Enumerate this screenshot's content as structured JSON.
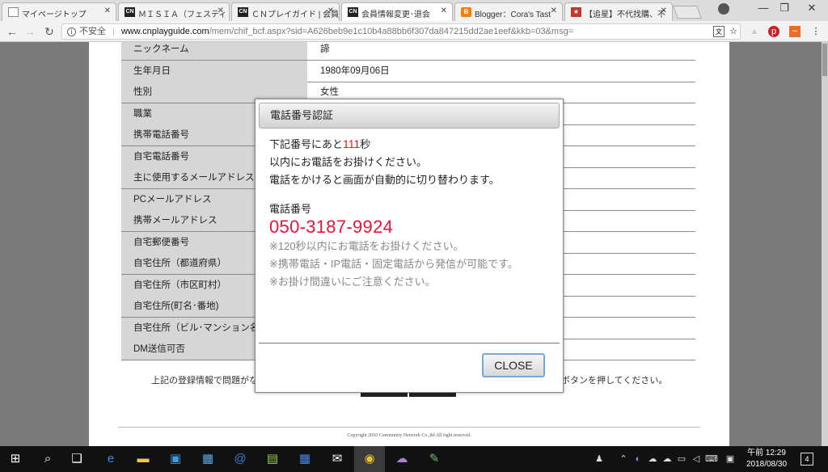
{
  "tabs": [
    {
      "favicon": "page-icon",
      "title": "マイページトップ"
    },
    {
      "favicon": "cn-icon",
      "title": "ＭＩＳＩＡ（フェスティ"
    },
    {
      "favicon": "cn-icon",
      "title": "ＣＮプレイガイド | 会員"
    },
    {
      "favicon": "cn-icon",
      "title": "会員情報変更･退会"
    },
    {
      "favicon": "blogger-icon",
      "title": "Blogger：Cora's Tast"
    },
    {
      "favicon": "red-icon",
      "title": "【追星】不代找購、不"
    }
  ],
  "address_bar": {
    "security_label": "不安全",
    "domain": "www.cnplayguide.com",
    "path": "/mem/chif_bcf.aspx?sid=A626beb9e1c10b4a88bb6f307da847215dd2ae1eef&kkb=03&msg="
  },
  "profile": {
    "rows": [
      {
        "label": "ニックネーム",
        "value": "諦"
      },
      {
        "label": "生年月日",
        "value": "1980年09月06日"
      },
      {
        "label": "性別",
        "value": "女性"
      },
      {
        "label": "職業",
        "value": ""
      },
      {
        "label": "携帯電話番号",
        "value": ""
      },
      {
        "label": "自宅電話番号",
        "value": ""
      },
      {
        "label": "主に使用するメールアドレス",
        "value": ""
      },
      {
        "label": "PCメールアドレス",
        "value": ""
      },
      {
        "label": "携帯メールアドレス",
        "value": ""
      },
      {
        "label": "自宅郵便番号",
        "value": ""
      },
      {
        "label": "自宅住所（都道府県）",
        "value": ""
      },
      {
        "label": "自宅住所（市区町村）",
        "value": ""
      },
      {
        "label": "自宅住所(町名･番地)",
        "value": ""
      },
      {
        "label": "自宅住所（ビル･マンション名",
        "value": ""
      },
      {
        "label": "DM送信可否",
        "value": ""
      }
    ],
    "note_left": "上記の登録情報で問題がな",
    "note_right": "ボタンを押してください。",
    "copyright": "Copyright 2010 Community Network Co.,ltd All right reserved."
  },
  "modal": {
    "title": "電話番号認証",
    "line1_before": "下記番号にあと",
    "seconds": "111",
    "line1_after": "秒",
    "line2": "以内にお電話をお掛けください。",
    "line3": "電話をかけると画面が自動的に切り替わります。",
    "phone_label": "電話番号",
    "phone_number": "050-3187-9924",
    "hint1": "※120秒以内にお電話をお掛けください。",
    "hint2": "※携帯電話・IP電話・固定電話から発信が可能です。",
    "hint3": "※お掛け間違いにご注意ください。",
    "close_label": "CLOSE"
  },
  "taskbar": {
    "clock_time": "12:29",
    "clock_ampm": "午前",
    "clock_date": "2018/08/30",
    "notification_count": "4"
  },
  "colors": {
    "countdown": "#e01018",
    "phone_number": "#e8143c",
    "hint_text": "#888888"
  }
}
